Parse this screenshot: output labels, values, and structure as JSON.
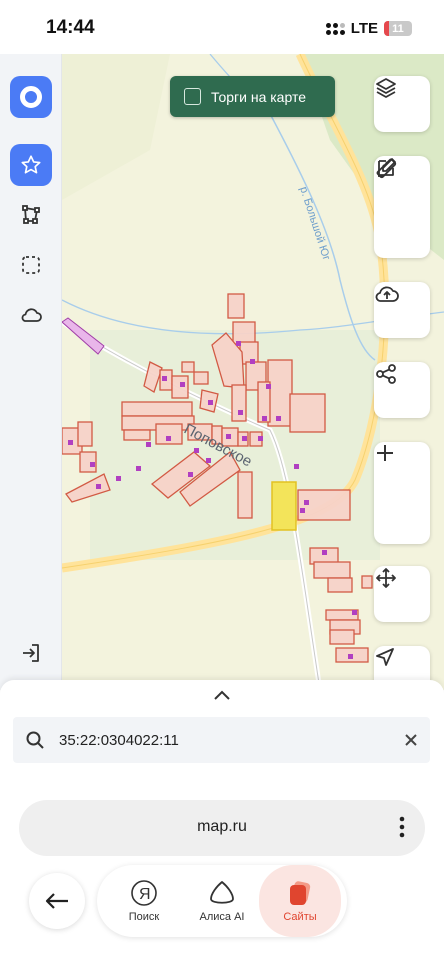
{
  "status_bar": {
    "time": "14:44",
    "network": "LTE",
    "battery": "11"
  },
  "map": {
    "auction_toggle_label": "Торги на карте",
    "village_label": "Поповское",
    "river_label": "р. Большой Юг"
  },
  "sidebar": {
    "icons": [
      "logo-icon",
      "star-icon",
      "polygon-icon",
      "selection-icon",
      "cloud-icon",
      "logout-icon"
    ]
  },
  "map_controls": {
    "icons": [
      "layers-icon",
      "ruler-icon",
      "edit-icon",
      "cloud-upload-icon",
      "share-icon",
      "zoom-in-icon",
      "zoom-out-icon",
      "move-icon",
      "locate-icon"
    ]
  },
  "search": {
    "query": "35:22:0304022:11"
  },
  "browser": {
    "url": "map.ru",
    "tabs": [
      {
        "label": "Поиск",
        "icon": "yandex-icon"
      },
      {
        "label": "Алиса AI",
        "icon": "alice-icon"
      },
      {
        "label": "Сайты",
        "icon": "sites-icon"
      }
    ]
  },
  "colors": {
    "accent": "#4b7bf5",
    "auction_bg": "#2f6b4f",
    "parcel_fill": "#f7d3c9",
    "parcel_stroke": "#d1533d",
    "selected_parcel": "#f3e45a",
    "active_tab": "#e0452f"
  }
}
